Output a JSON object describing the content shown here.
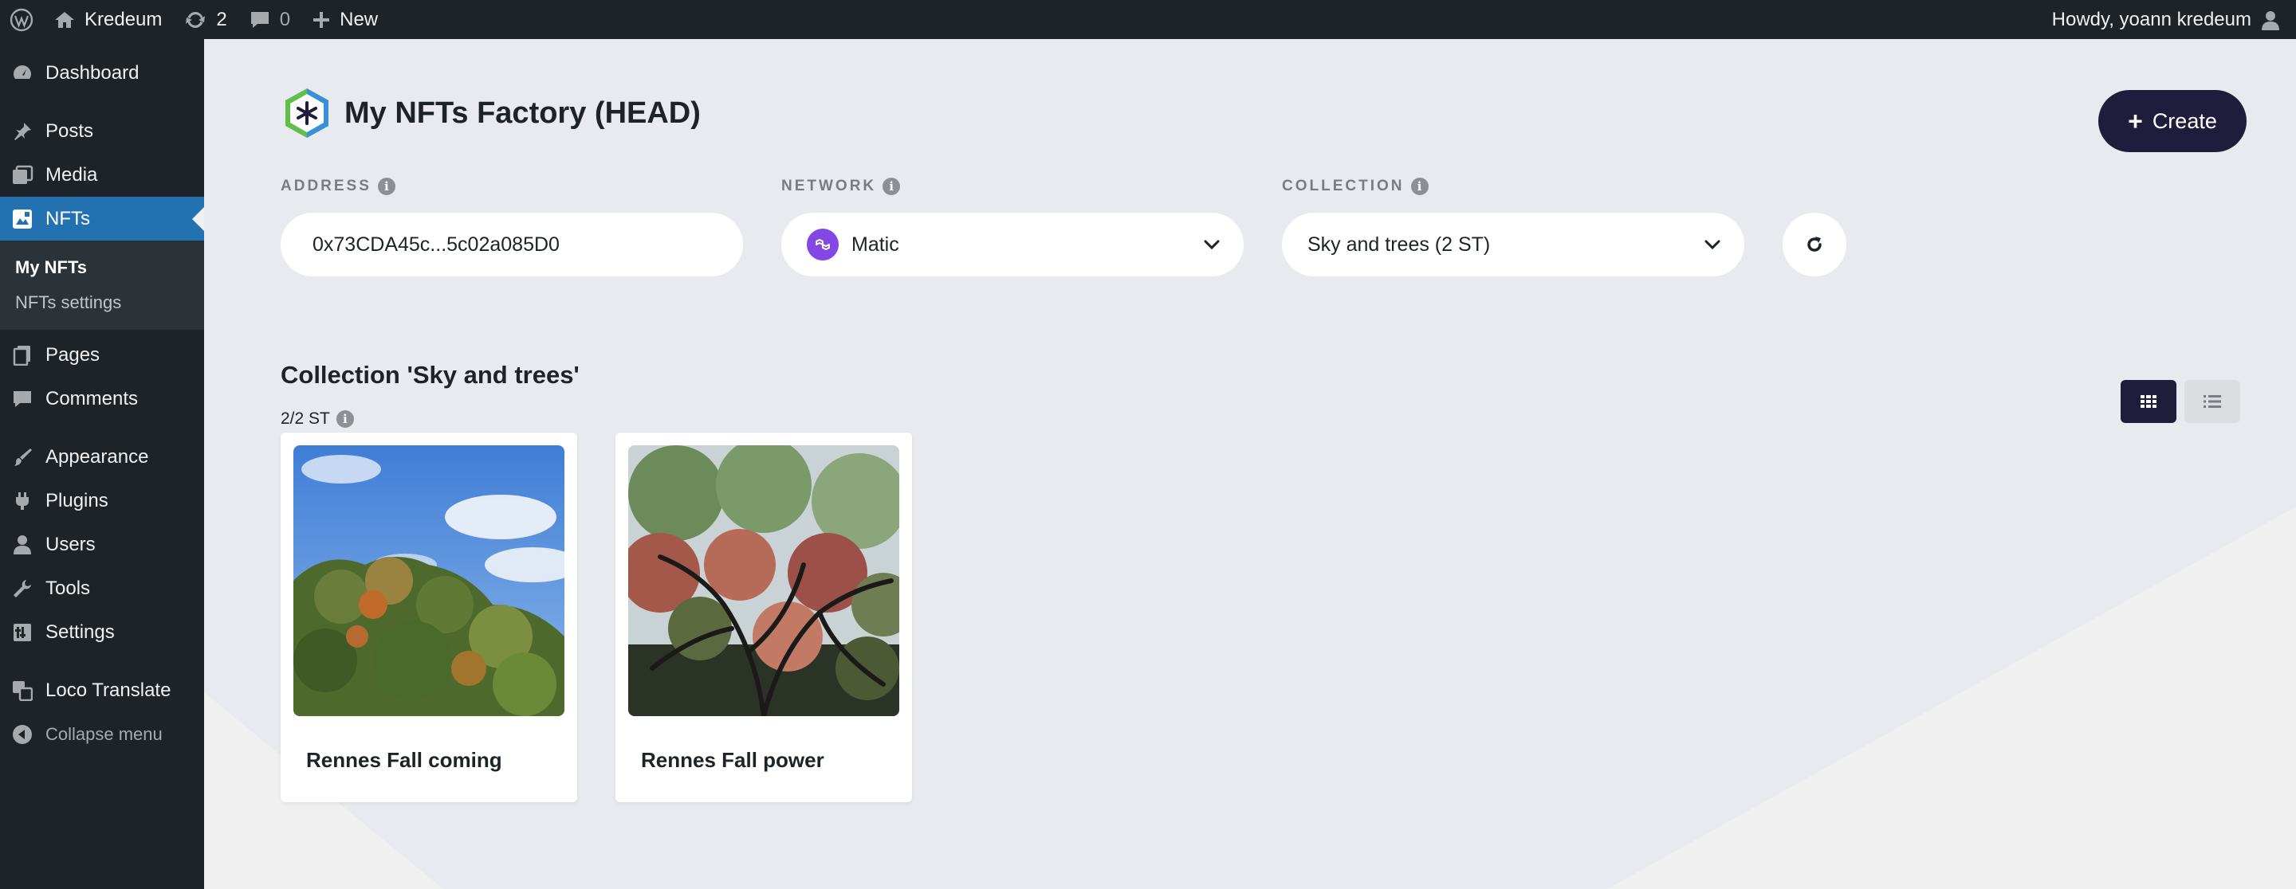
{
  "admin_bar": {
    "site_name": "Kredeum",
    "updates_count": "2",
    "comments_count": "0",
    "new_label": "New",
    "howdy": "Howdy, yoann kredeum"
  },
  "sidebar": {
    "items": [
      {
        "label": "Dashboard",
        "icon": "dashboard-icon"
      },
      {
        "label": "Posts",
        "icon": "pin-icon"
      },
      {
        "label": "Media",
        "icon": "media-icon"
      },
      {
        "label": "NFTs",
        "icon": "nft-icon"
      },
      {
        "label": "Pages",
        "icon": "pages-icon"
      },
      {
        "label": "Comments",
        "icon": "comments-icon"
      },
      {
        "label": "Appearance",
        "icon": "brush-icon"
      },
      {
        "label": "Plugins",
        "icon": "plug-icon"
      },
      {
        "label": "Users",
        "icon": "user-icon"
      },
      {
        "label": "Tools",
        "icon": "wrench-icon"
      },
      {
        "label": "Settings",
        "icon": "settings-icon"
      },
      {
        "label": "Loco Translate",
        "icon": "translate-icon"
      }
    ],
    "submenu": [
      "My NFTs",
      "NFTs settings"
    ],
    "collapse_label": "Collapse menu"
  },
  "page": {
    "title": "My NFTs Factory (HEAD)",
    "create_label": "Create",
    "address_label": "ADDRESS",
    "address_value": "0x73CDA45c...5c02a085D0",
    "network_label": "NETWORK",
    "network_value": "Matic",
    "collection_label": "COLLECTION",
    "collection_value": "Sky and trees (2 ST)",
    "collection_title": "Collection 'Sky and trees'",
    "collection_count": "2/2 ST"
  },
  "nfts": [
    {
      "name": "Rennes Fall coming"
    },
    {
      "name": "Rennes Fall power"
    }
  ],
  "colors": {
    "admin_bg": "#1d2327",
    "active_menu": "#2271b1",
    "dark_button": "#1e1e3c",
    "matic_purple": "#8247e5"
  }
}
